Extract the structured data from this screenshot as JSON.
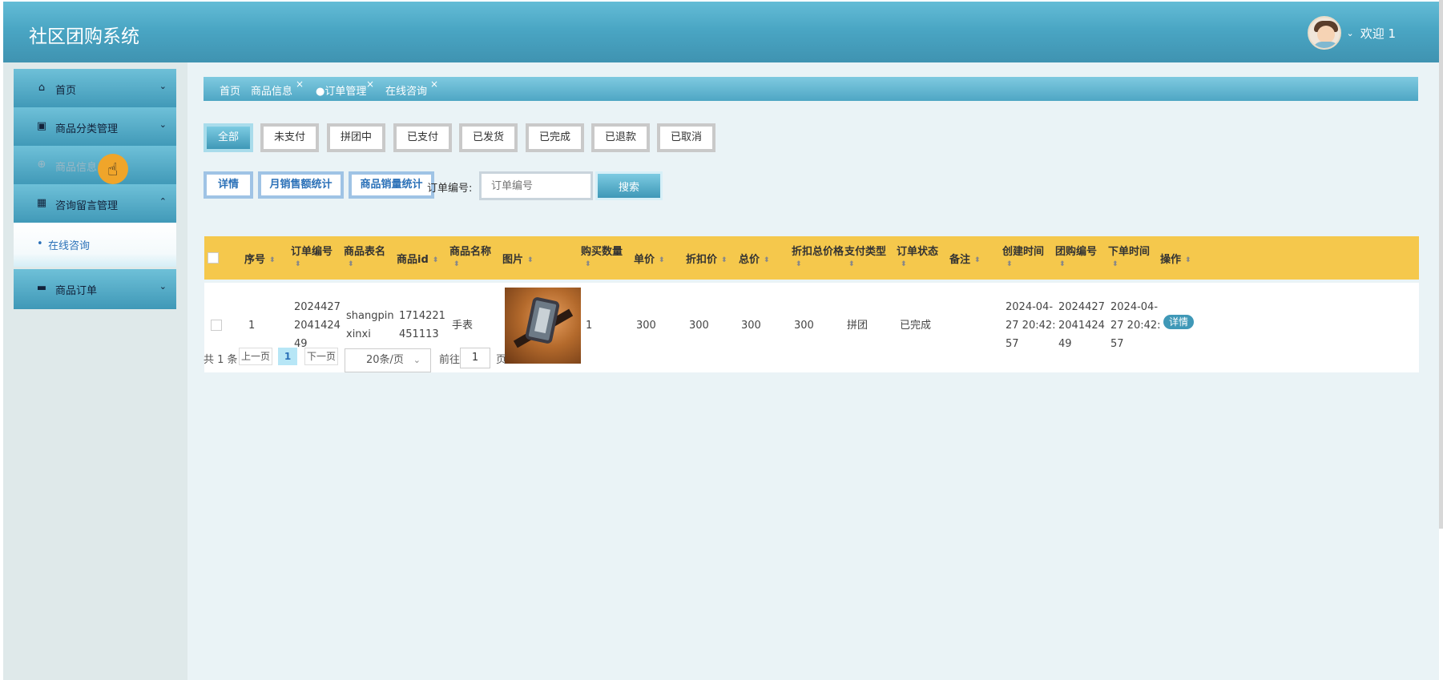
{
  "app": {
    "title": "社区团购系统",
    "welcome": "欢迎 1"
  },
  "sidebar": {
    "items": [
      {
        "label": "首页",
        "icon": "home-icon"
      },
      {
        "label": "商品分类管理",
        "icon": "book-icon"
      },
      {
        "label": "商品信息",
        "icon": "plus-circle-icon"
      },
      {
        "label": "咨询留言管理",
        "icon": "chip-icon"
      },
      {
        "label": "商品订单",
        "icon": "card-icon"
      }
    ],
    "submenu": {
      "label": "在线咨询"
    }
  },
  "tabs": [
    {
      "label": "首页"
    },
    {
      "label": "商品信息"
    },
    {
      "label": "订单管理"
    },
    {
      "label": "在线咨询"
    }
  ],
  "filters": [
    "全部",
    "未支付",
    "拼团中",
    "已支付",
    "已发货",
    "已完成",
    "已退款",
    "已取消"
  ],
  "actions": {
    "detail": "详情",
    "monthly_sales": "月销售额统计",
    "product_sales": "商品销量统计",
    "order_no_label": "订单编号:",
    "order_no_placeholder": "订单编号",
    "search": "搜索"
  },
  "table": {
    "headers": [
      "序号",
      "订单编号",
      "商品表名",
      "商品id",
      "商品名称",
      "图片",
      "购买数量",
      "单价",
      "折扣价",
      "总价",
      "折扣总价格",
      "支付类型",
      "订单状态",
      "备注",
      "创建时间",
      "团购编号",
      "下单时间",
      "操作"
    ],
    "rows": [
      {
        "index": "1",
        "order_no": [
          "2024427",
          "2041424",
          "49"
        ],
        "table_name": [
          "shangpin",
          "xinxi"
        ],
        "product_id": [
          "1714221",
          "451113"
        ],
        "product_name": "手表",
        "quantity": "1",
        "unit_price": "300",
        "discount_price": "300",
        "total": "300",
        "discount_total": "300",
        "pay_type": "拼团",
        "status": "已完成",
        "remark": "",
        "created": [
          "2024-04-",
          "27 20:42:",
          "57"
        ],
        "group_no": [
          "2024427",
          "2041424",
          "49"
        ],
        "order_time": [
          "2024-04-",
          "27 20:42:",
          "57"
        ],
        "op": "详情"
      }
    ]
  },
  "pagination": {
    "total": "共 1 条",
    "prev": "上一页",
    "current": "1",
    "next": "下一页",
    "page_size": "20条/页",
    "goto_label": "前往",
    "goto_value": "1",
    "goto_suffix": "页"
  },
  "colors": {
    "header": "#4aa6c4",
    "table_header": "#f5c84c",
    "accent": "#3f98b7"
  }
}
